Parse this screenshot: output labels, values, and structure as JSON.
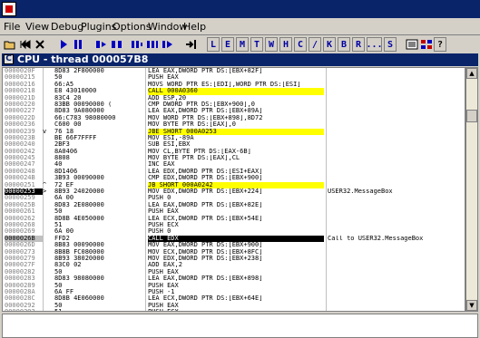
{
  "window": {
    "title": ""
  },
  "menu": [
    "File",
    "View",
    "Debug",
    "Plugins",
    "Options",
    "Window",
    "Help"
  ],
  "toolbar": {
    "letters": [
      "L",
      "E",
      "M",
      "T",
      "W",
      "H",
      "C",
      "/",
      "K",
      "B",
      "R",
      "...",
      "S"
    ]
  },
  "cpu_window": {
    "title": "CPU - thread 000057B8"
  },
  "rows": [
    {
      "addr": "0000020F",
      "jmp": "",
      "hex": "8D83 2F800000",
      "dis": "LEA EAX,DWORD PTR DS:[EBX+82F]",
      "com": "",
      "style": ""
    },
    {
      "addr": "00000215",
      "jmp": "",
      "hex": "50",
      "dis": "PUSH EAX",
      "com": "",
      "style": ""
    },
    {
      "addr": "00000216",
      "jmp": "",
      "hex": "66:A5",
      "dis": "MOVS WORD PTR ES:[EDI],WORD PTR DS:[ESI]",
      "com": "",
      "style": ""
    },
    {
      "addr": "00000218",
      "jmp": "",
      "hex": "E8 43010000",
      "dis": "CALL 000A0360",
      "com": "",
      "style": "hl"
    },
    {
      "addr": "0000021D",
      "jmp": "",
      "hex": "83C4 20",
      "dis": "ADD ESP,20",
      "com": "",
      "style": ""
    },
    {
      "addr": "00000220",
      "jmp": "",
      "hex": "83BB 00090000 (",
      "dis": "CMP DWORD PTR DS:[EBX+900],0",
      "com": "",
      "style": ""
    },
    {
      "addr": "00000227",
      "jmp": "",
      "hex": "8D83 9A080000",
      "dis": "LEA EAX,DWORD PTR DS:[EBX+89A]",
      "com": "",
      "style": ""
    },
    {
      "addr": "0000022D",
      "jmp": "",
      "hex": "66:C783 98080000",
      "dis": "MOV WORD PTR DS:[EBX+898],8D72",
      "com": "",
      "style": ""
    },
    {
      "addr": "00000236",
      "jmp": "",
      "hex": "C600 00",
      "dis": "MOV BYTE PTR DS:[EAX],0",
      "com": "",
      "style": ""
    },
    {
      "addr": "00000239",
      "jmp": "v",
      "hex": "76 18",
      "dis": "JBE SHORT 000A0253",
      "com": "",
      "style": "hl"
    },
    {
      "addr": "0000023B",
      "jmp": "",
      "hex": "BE 66F7FFFF",
      "dis": "MOV ESI,-89A",
      "com": "",
      "style": ""
    },
    {
      "addr": "00000240",
      "jmp": "",
      "hex": "2BF3",
      "dis": "SUB ESI,EBX",
      "com": "",
      "style": ""
    },
    {
      "addr": "00000242",
      "jmp": "",
      "hex": "8A0406",
      "dis": "MOV CL,BYTE PTR DS:[EAX-6B]",
      "com": "",
      "style": ""
    },
    {
      "addr": "00000245",
      "jmp": "",
      "hex": "8808",
      "dis": "MOV BYTE PTR DS:[EAX],CL",
      "com": "",
      "style": ""
    },
    {
      "addr": "00000247",
      "jmp": "",
      "hex": "40",
      "dis": "INC EAX",
      "com": "",
      "style": ""
    },
    {
      "addr": "00000248",
      "jmp": "",
      "hex": "8D1406",
      "dis": "LEA EDX,DWORD PTR DS:[ESI+EAX]",
      "com": "",
      "style": ""
    },
    {
      "addr": "0000024B",
      "jmp": "",
      "hex": "3B93 00090000",
      "dis": "CMP EDX,DWORD PTR DS:[EBX+900]",
      "com": "",
      "style": ""
    },
    {
      "addr": "00000251",
      "jmp": "^",
      "hex": "72 EF",
      "dis": "JB SHORT 000A0242",
      "com": "",
      "style": "hl"
    },
    {
      "addr": "00000253",
      "jmp": ">",
      "hex": "8B93 24020000",
      "dis": "MOV EDX,DWORD PTR DS:[EBX+224]",
      "com": "USER32.MessageBox",
      "style": "sel"
    },
    {
      "addr": "00000259",
      "jmp": "",
      "hex": "6A 00",
      "dis": "PUSH 0",
      "com": "",
      "style": ""
    },
    {
      "addr": "0000025B",
      "jmp": "",
      "hex": "8D83 2E080000",
      "dis": "LEA EAX,DWORD PTR DS:[EBX+82E]",
      "com": "",
      "style": ""
    },
    {
      "addr": "00000261",
      "jmp": "",
      "hex": "50",
      "dis": "PUSH EAX",
      "com": "",
      "style": ""
    },
    {
      "addr": "00000262",
      "jmp": "",
      "hex": "8D8B 4E050000",
      "dis": "LEA ECX,DWORD PTR DS:[EBX+54E]",
      "com": "",
      "style": ""
    },
    {
      "addr": "00000268",
      "jmp": "",
      "hex": "51",
      "dis": "PUSH ECX",
      "com": "",
      "style": ""
    },
    {
      "addr": "00000269",
      "jmp": "",
      "hex": "6A 00",
      "dis": "PUSH 0",
      "com": "",
      "style": ""
    },
    {
      "addr": "0000026B",
      "jmp": "",
      "hex": "FFD2",
      "dis": "CALL EDX",
      "com": "Call to USER32.MessageBox",
      "style": "call mark"
    },
    {
      "addr": "0000026D",
      "jmp": "",
      "hex": "8B83 00090000",
      "dis": "MOV EAX,DWORD PTR DS:[EBX+900]",
      "com": "",
      "style": ""
    },
    {
      "addr": "00000273",
      "jmp": "",
      "hex": "8B8B FC080000",
      "dis": "MOV ECX,DWORD PTR DS:[EBX+8FC]",
      "com": "",
      "style": ""
    },
    {
      "addr": "00000279",
      "jmp": "",
      "hex": "8B93 38020000",
      "dis": "MOV EDX,DWORD PTR DS:[EBX+238]",
      "com": "",
      "style": ""
    },
    {
      "addr": "0000027F",
      "jmp": "",
      "hex": "83C0 02",
      "dis": "ADD EAX,2",
      "com": "",
      "style": ""
    },
    {
      "addr": "00000282",
      "jmp": "",
      "hex": "50",
      "dis": "PUSH EAX",
      "com": "",
      "style": ""
    },
    {
      "addr": "00000283",
      "jmp": "",
      "hex": "8D83 98080000",
      "dis": "LEA EAX,DWORD PTR DS:[EBX+898]",
      "com": "",
      "style": ""
    },
    {
      "addr": "00000289",
      "jmp": "",
      "hex": "50",
      "dis": "PUSH EAX",
      "com": "",
      "style": ""
    },
    {
      "addr": "0000028A",
      "jmp": "",
      "hex": "6A FF",
      "dis": "PUSH -1",
      "com": "",
      "style": ""
    },
    {
      "addr": "0000028C",
      "jmp": "",
      "hex": "8D8B 4E060000",
      "dis": "LEA ECX,DWORD PTR DS:[EBX+64E]",
      "com": "",
      "style": ""
    },
    {
      "addr": "00000292",
      "jmp": "",
      "hex": "50",
      "dis": "PUSH EAX",
      "com": "",
      "style": ""
    },
    {
      "addr": "00000293",
      "jmp": "",
      "hex": "51",
      "dis": "PUSH ECX",
      "com": "",
      "style": ""
    }
  ]
}
